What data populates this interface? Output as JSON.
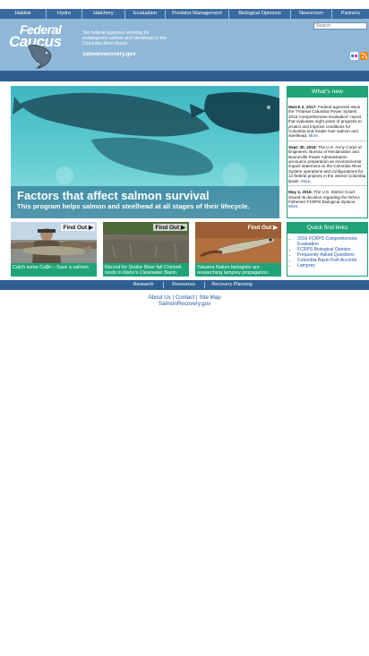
{
  "nav": {
    "items": [
      "Habitat",
      "Hydro",
      "Hatchery",
      "Evaluation",
      "Predator Management",
      "Biological Opinions",
      "Newsroom",
      "Partners"
    ]
  },
  "header": {
    "logo_word1": "Federal",
    "logo_word2": "Caucus",
    "tagline": "Ten federal agencies working for endangered salmon and steelhead in the Columbia River Basin",
    "site_url": "salmonrecovery.gov",
    "search_placeholder": "Search",
    "icons": [
      "flickr-icon",
      "rss-icon"
    ]
  },
  "hero": {
    "title": "Factors that affect salmon survival",
    "subtitle": "This program helps salmon and steelhead at all stages of their lifecycle."
  },
  "thumbs": [
    {
      "label": "Find Out ▶",
      "caption": "Catch some Ca$h – Save a salmon"
    },
    {
      "label": "Find Out ▶",
      "caption": "Record for Snake River fall Chinook nests in Idaho's Clearwater Basin"
    },
    {
      "label": "Find Out ▶",
      "caption": "Yakama Nation biologists are researching lamprey propagation."
    }
  ],
  "whats_new": {
    "heading": "What's new",
    "items": [
      {
        "date": "March 2, 2017:",
        "text": " Federal agencies issue the \"Federal Columbia Power System 2016 Comprehensive Evaluation\" report that evaluates eight years of progress to protect and improve conditions for Columbia and Snake river salmon and steelhead. ",
        "more": "More."
      },
      {
        "date": "Sept. 30, 2016:",
        "text": " The U.S. Army Corps of Engineers, Bureau of Reclamation and Bonneville Power Administration announce preparation an environmental impact statement on the Columbia River System operations and configurations for 14 federal projects in the interior Columbia Basin. ",
        "more": "More."
      },
      {
        "date": "May 4, 2016:",
        "text": " The U.S. District Court issued its decision regarding the NOAA Fisheries' FCRPS Biological Opinion. ",
        "more": "More."
      }
    ]
  },
  "quick_links": {
    "heading": "Quick find links",
    "items": [
      "2016 FCRPS Comprehensive Evaluation",
      "FCRPS Biological Opinion",
      "Frequently Asked Questions",
      "Columbia Basin Fish Accords",
      "Lamprey"
    ]
  },
  "bottom_nav": {
    "items": [
      "Research",
      "Resources",
      "Recovery Planning"
    ]
  },
  "footer": {
    "links": [
      "About Us",
      "Contact",
      "Site Map"
    ],
    "separator": "|",
    "url": "SalmonRecovery.gov"
  },
  "colors": {
    "nav_blue": "#3a6aa0",
    "header_blue": "#8fb7d7",
    "accent_green": "#1fa47a",
    "link_blue": "#1c55a4"
  }
}
